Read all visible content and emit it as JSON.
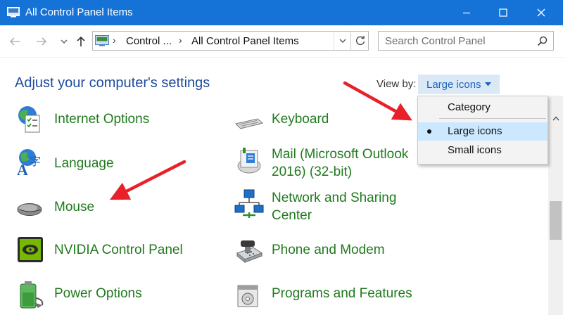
{
  "window": {
    "title": "All Control Panel Items",
    "title_bar_color": "#1573d8"
  },
  "navigation": {
    "breadcrumbs": [
      "Control ...",
      "All Control Panel Items"
    ],
    "search_placeholder": "Search Control Panel"
  },
  "main": {
    "heading": "Adjust your computer's settings",
    "view_by_label": "View by:",
    "view_by_value": "Large icons"
  },
  "view_menu": {
    "options": [
      "Category",
      "Large icons",
      "Small icons"
    ],
    "selected": "Large icons"
  },
  "items": [
    {
      "label": "Internet Options",
      "icon": "internet-options-icon"
    },
    {
      "label": "Keyboard",
      "icon": "keyboard-icon"
    },
    {
      "label": "Language",
      "icon": "language-icon"
    },
    {
      "label_lines": [
        "Mail (Microsoft Outlook",
        "2016) (32-bit)"
      ],
      "icon": "mail-icon"
    },
    {
      "label": "Mouse",
      "icon": "mouse-icon"
    },
    {
      "label_lines": [
        "Network and Sharing",
        "Center"
      ],
      "icon": "network-icon"
    },
    {
      "label": "NVIDIA Control Panel",
      "icon": "nvidia-icon"
    },
    {
      "label": "Phone and Modem",
      "icon": "phone-modem-icon"
    },
    {
      "label": "Power Options",
      "icon": "power-options-icon"
    },
    {
      "label": "Programs and Features",
      "icon": "programs-features-icon"
    }
  ],
  "colors": {
    "link_green": "#207a1e",
    "heading_blue": "#1e4c9e",
    "annotation_arrow": "#e8202a"
  }
}
